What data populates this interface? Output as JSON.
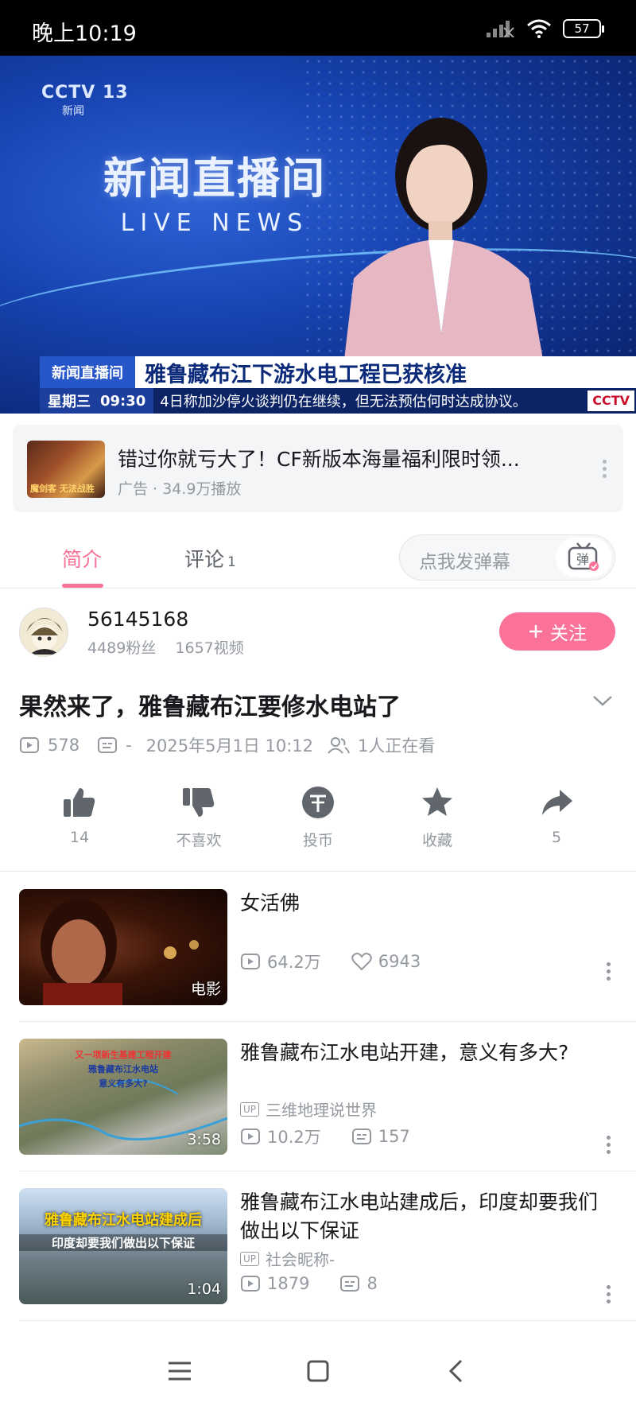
{
  "status_bar": {
    "time": "晚上10:19",
    "battery": "57"
  },
  "player": {
    "channel_logo": "CCTV 13",
    "channel_sub": "新闻",
    "show_title_cn": "新闻直播间",
    "show_title_en": "LIVE NEWS",
    "ticker_tag": "新闻直播间",
    "headline": "雅鲁藏布江下游水电工程已获核准",
    "weekday": "星期三",
    "clock": "09:30",
    "scroll_text": "4日称加沙停火谈判仍在继续，但无法预估何时达成协议。",
    "watermark": "CCTV",
    "progress": 0.25
  },
  "ad": {
    "thumb_text": "魔剑客 无法战胜",
    "title": "错过你就亏大了！CF新版本海量福利限时领...",
    "meta": "广告 · 34.9万播放"
  },
  "tabs": {
    "intro": "简介",
    "comments": "评论",
    "comments_count": "1",
    "danmaku_placeholder": "点我发弹幕",
    "danmaku_icon_label": "弹"
  },
  "uploader": {
    "name": "56145168",
    "fans": "4489粉丝",
    "videos": "1657视频",
    "follow_label": "关注"
  },
  "video": {
    "title": "果然来了，雅鲁藏布江要修水电站了",
    "views": "578",
    "danmaku_count": "-",
    "date": "2025年5月1日 10:12",
    "watching": "1人正在看"
  },
  "actions": {
    "like": "14",
    "dislike": "不喜欢",
    "coin": "投币",
    "favorite": "收藏",
    "share": "5"
  },
  "recommendations": [
    {
      "title": "女活佛",
      "badge": "电影",
      "views": "64.2万",
      "likes": "6943"
    },
    {
      "title": "雅鲁藏布江水电站开建，意义有多大?",
      "badge": "3:58",
      "uploader": "三维地理说世界",
      "views": "10.2万",
      "danmaku": "157",
      "thumb_line1": "又一项新生基建工程开建",
      "thumb_line2": "雅鲁藏布江水电站",
      "thumb_line3": "意义有多大?"
    },
    {
      "title": "雅鲁藏布江水电站建成后，印度却要我们做出以下保证",
      "badge": "1:04",
      "uploader": "社会昵称-",
      "views": "1879",
      "danmaku": "8",
      "thumb_line1": "雅鲁藏布江水电站建成后",
      "thumb_line2": "印度却要我们做出以下保证"
    }
  ],
  "up_tag": "UP",
  "colors": {
    "accent": "#fb7299",
    "muted": "#9499a0",
    "text": "#18191c"
  }
}
